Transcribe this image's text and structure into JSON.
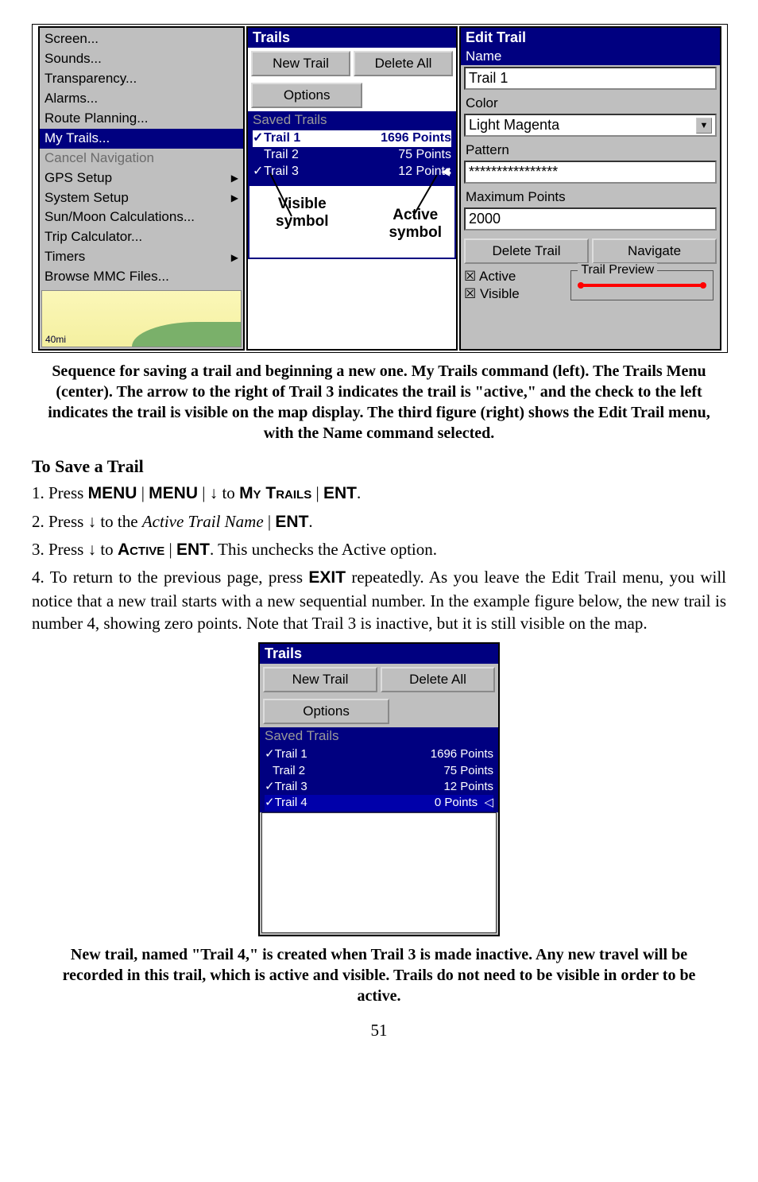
{
  "left_menu": {
    "items": [
      {
        "label": "Screen...",
        "submenu": false
      },
      {
        "label": "Sounds...",
        "submenu": false
      },
      {
        "label": "Transparency...",
        "submenu": false
      },
      {
        "label": "Alarms...",
        "submenu": false
      },
      {
        "label": "Route Planning...",
        "submenu": false
      },
      {
        "label": "My Trails...",
        "submenu": false,
        "highlight": true
      },
      {
        "label": "Cancel Navigation",
        "submenu": false,
        "disabled": true
      },
      {
        "label": "GPS Setup",
        "submenu": true
      },
      {
        "label": "System Setup",
        "submenu": true
      },
      {
        "label": "Sun/Moon Calculations...",
        "submenu": false
      },
      {
        "label": "Trip Calculator...",
        "submenu": false
      },
      {
        "label": "Timers",
        "submenu": true
      },
      {
        "label": "Browse MMC Files...",
        "submenu": false
      }
    ],
    "scale": "40mi"
  },
  "center": {
    "title": "Trails",
    "btn_new": "New Trail",
    "btn_delete": "Delete All",
    "btn_options": "Options",
    "subheader": "Saved Trails",
    "trails": [
      {
        "check": "✓",
        "name": "Trail 1",
        "pts": "1696 Points",
        "sel": true
      },
      {
        "check": "",
        "name": "Trail 2",
        "pts": "75 Points"
      },
      {
        "check": "✓",
        "name": "Trail 3",
        "pts": "12 Points",
        "active": true
      }
    ],
    "vis_label_1": "Visible",
    "vis_label_2": "symbol",
    "act_label_1": "Active",
    "act_label_2": "symbol"
  },
  "right": {
    "title": "Edit Trail",
    "name_label": "Name",
    "name_value": "Trail 1",
    "color_label": "Color",
    "color_value": "Light Magenta",
    "pattern_label": "Pattern",
    "pattern_value": "****************",
    "maxpts_label": "Maximum Points",
    "maxpts_value": "2000",
    "btn_delete": "Delete Trail",
    "btn_nav": "Navigate",
    "preview_legend": "Trail Preview",
    "chk_active": "Active",
    "chk_visible": "Visible"
  },
  "caption1": "Sequence for saving a trail and beginning a new one. My Trails command (left). The Trails Menu (center). The arrow to the right of Trail 3 indicates the trail is \"active,\" and the check to the left indicates the trail is visible on the map display. The third figure (right) shows the Edit Trail menu, with the Name command selected.",
  "section_heading": "To Save a Trail",
  "step1_a": "1. Press ",
  "step1_menu": "MENU",
  "step1_bar": " | ",
  "step1_down": "↓",
  "step1_to": " to ",
  "step1_mytrails": "My Trails",
  "step1_ent": "ENT",
  "step1_period": ".",
  "step2_a": "2. Press ",
  "step2_to": " to the ",
  "step2_italic": "Active Trail Name",
  "step3_a": "3. Press ",
  "step3_active": "Active",
  "step3_tail": ". This unchecks the Active option.",
  "para4": "4. To return to the previous page, press ",
  "para4_exit": "EXIT",
  "para4_tail": " repeatedly. As you leave the Edit Trail menu, you will notice that a new trail starts with a new sequential number. In the example figure below, the new trail is number 4, showing zero points. Note that Trail 3 is inactive, but it is still visible on the map.",
  "fig2": {
    "title": "Trails",
    "btn_new": "New Trail",
    "btn_delete": "Delete All",
    "btn_options": "Options",
    "subheader": "Saved Trails",
    "trails": [
      {
        "check": "✓",
        "name": "Trail 1",
        "pts": "1696 Points"
      },
      {
        "check": "",
        "name": "Trail 2",
        "pts": "75 Points"
      },
      {
        "check": "✓",
        "name": "Trail 3",
        "pts": "12 Points"
      },
      {
        "check": "✓",
        "name": "Trail 4",
        "pts": "0 Points",
        "sel": true,
        "arrow": true
      }
    ]
  },
  "caption2": "New trail, named \"Trail 4,\" is created when Trail 3 is made inactive. Any new travel will be recorded in this trail, which is active and visible. Trails do not need to be visible in order to be active.",
  "page_number": "51"
}
